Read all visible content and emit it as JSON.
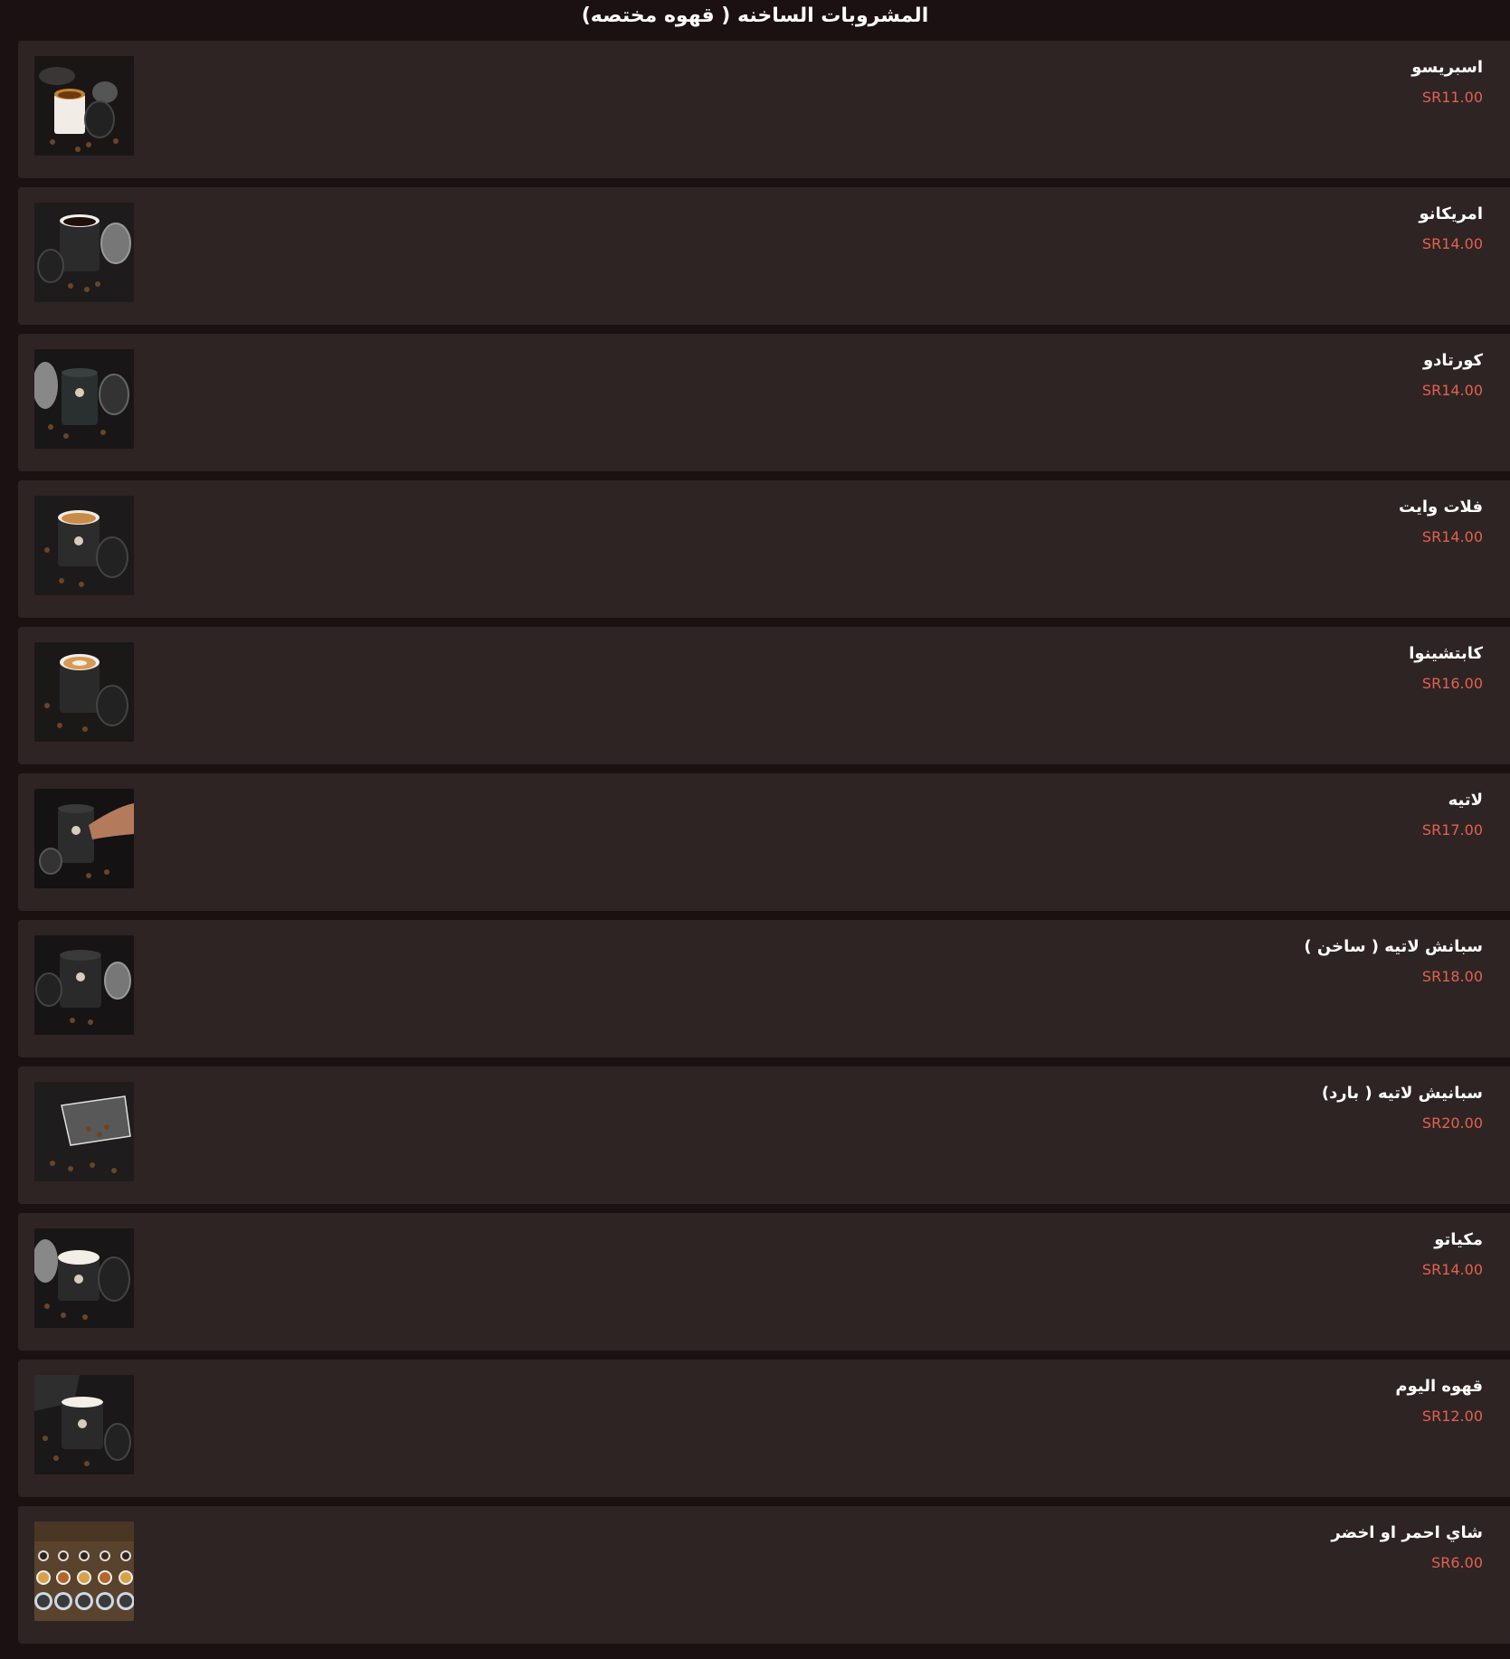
{
  "section": {
    "title": "المشروبات الساخنه ( قهوه مختصه)"
  },
  "items": [
    {
      "name": "اسبريسو",
      "price": "SR11.00",
      "photo": "coffee-cup-photo"
    },
    {
      "name": "امريكانو",
      "price": "SR14.00",
      "photo": "coffee-cup-photo"
    },
    {
      "name": "كورتادو",
      "price": "SR14.00",
      "photo": "coffee-cup-photo"
    },
    {
      "name": "فلات وايت",
      "price": "SR14.00",
      "photo": "coffee-cup-photo"
    },
    {
      "name": "كابتشينوا",
      "price": "SR16.00",
      "photo": "coffee-cup-photo"
    },
    {
      "name": "لاتيه",
      "price": "SR17.00",
      "photo": "coffee-cup-photo"
    },
    {
      "name": "سبانش لاتيه ( ساخن )",
      "price": "SR18.00",
      "photo": "coffee-cup-photo"
    },
    {
      "name": "سبانيش لاتيه ( بارد)",
      "price": "SR20.00",
      "photo": "glass-coffee-beans-photo"
    },
    {
      "name": "مكياتو",
      "price": "SR14.00",
      "photo": "coffee-cup-photo"
    },
    {
      "name": "قهوه اليوم",
      "price": "SR12.00",
      "photo": "coffee-cup-photo"
    },
    {
      "name": "شاي احمر او اخضر",
      "price": "SR6.00",
      "photo": "tea-cups-photo"
    }
  ],
  "colors": {
    "page_background": "#1b1112",
    "card_background": "#2e2424",
    "price_text": "#e2614f",
    "name_text": "#ffffff"
  }
}
